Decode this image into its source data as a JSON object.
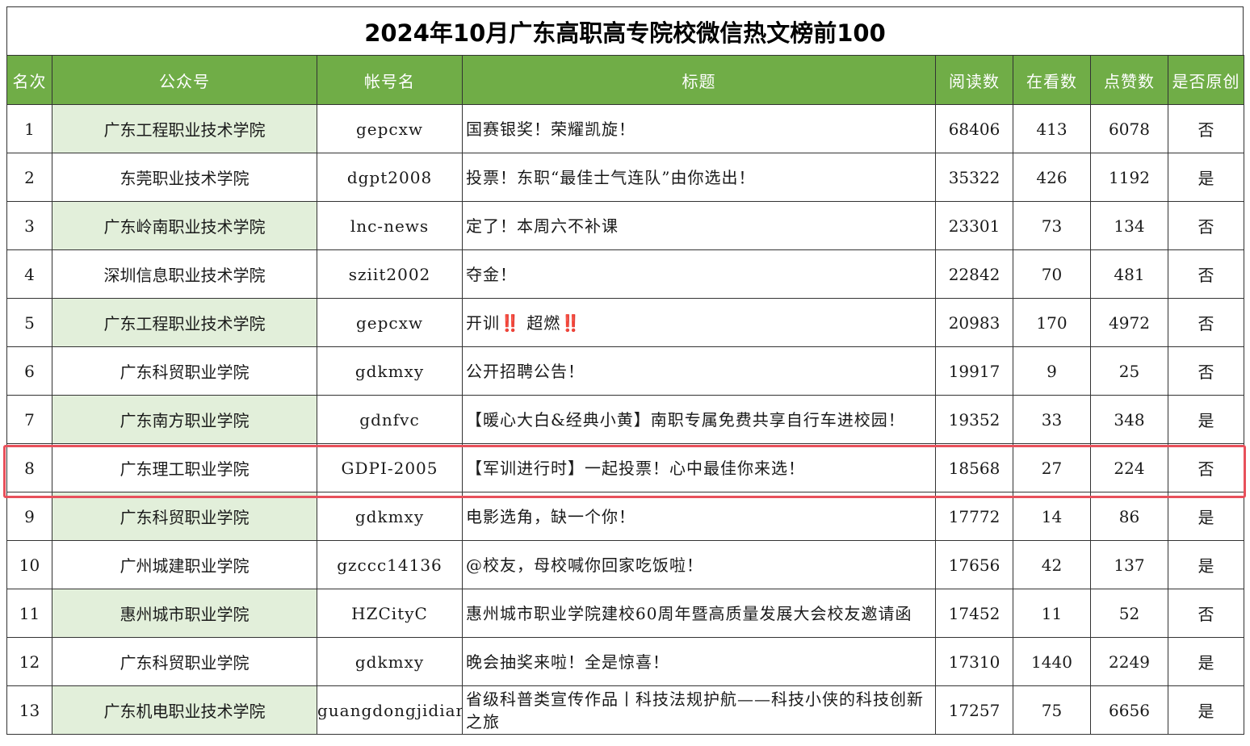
{
  "title": "2024年10月广东高职高专院校微信热文榜前100",
  "headers": {
    "rank": "名次",
    "account": "公众号",
    "account_id": "帐号名",
    "article_title": "标题",
    "reads": "阅读数",
    "watching": "在看数",
    "likes": "点赞数",
    "original": "是否原创"
  },
  "colors": {
    "header_bg": "#70ad47",
    "row_shade": "#e2efda",
    "highlight_border": "#e8505b"
  },
  "highlighted_rank": "8",
  "rows": [
    {
      "rank": "1",
      "account": "广东工程职业技术学院",
      "account_id": "gepcxw",
      "title": "国赛银奖！荣耀凯旋！",
      "reads": "68406",
      "watching": "413",
      "likes": "6078",
      "original": "否"
    },
    {
      "rank": "2",
      "account": "东莞职业技术学院",
      "account_id": "dgpt2008",
      "title": "投票！东职“最佳士气连队”由你选出！",
      "reads": "35322",
      "watching": "426",
      "likes": "1192",
      "original": "是"
    },
    {
      "rank": "3",
      "account": "广东岭南职业技术学院",
      "account_id": "lnc-news",
      "title": "定了！本周六不补课",
      "reads": "23301",
      "watching": "73",
      "likes": "134",
      "original": "否"
    },
    {
      "rank": "4",
      "account": "深圳信息职业技术学院",
      "account_id": "sziit2002",
      "title": "夺金！",
      "reads": "22842",
      "watching": "70",
      "likes": "481",
      "original": "否"
    },
    {
      "rank": "5",
      "account": "广东工程职业技术学院",
      "account_id": "gepcxw",
      "title": "开训‼️ 超燃‼️",
      "reads": "20983",
      "watching": "170",
      "likes": "4972",
      "original": "否"
    },
    {
      "rank": "6",
      "account": "广东科贸职业学院",
      "account_id": "gdkmxy",
      "title": "公开招聘公告！",
      "reads": "19917",
      "watching": "9",
      "likes": "25",
      "original": "否"
    },
    {
      "rank": "7",
      "account": "广东南方职业学院",
      "account_id": "gdnfvc",
      "title": "【暖心大白&经典小黄】南职专属免费共享自行车进校园！",
      "reads": "19352",
      "watching": "33",
      "likes": "348",
      "original": "是"
    },
    {
      "rank": "8",
      "account": "广东理工职业学院",
      "account_id": "GDPI-2005",
      "title": "【军训进行时】一起投票！心中最佳你来选！",
      "reads": "18568",
      "watching": "27",
      "likes": "224",
      "original": "否"
    },
    {
      "rank": "9",
      "account": "广东科贸职业学院",
      "account_id": "gdkmxy",
      "title": "电影选角，缺一个你！",
      "reads": "17772",
      "watching": "14",
      "likes": "86",
      "original": "是"
    },
    {
      "rank": "10",
      "account": "广州城建职业学院",
      "account_id": "gzccc14136",
      "title": "@校友，母校喊你回家吃饭啦！",
      "reads": "17656",
      "watching": "42",
      "likes": "137",
      "original": "是"
    },
    {
      "rank": "11",
      "account": "惠州城市职业学院",
      "account_id": "HZCityC",
      "title": "惠州城市职业学院建校60周年暨高质量发展大会校友邀请函",
      "reads": "17452",
      "watching": "11",
      "likes": "52",
      "original": "否"
    },
    {
      "rank": "12",
      "account": "广东科贸职业学院",
      "account_id": "gdkmxy",
      "title": "晚会抽奖来啦！全是惊喜！",
      "reads": "17310",
      "watching": "1440",
      "likes": "2249",
      "original": "是"
    },
    {
      "rank": "13",
      "account": "广东机电职业技术学院",
      "account_id": "guangdongjidian",
      "title": "省级科普类宣传作品丨科技法规护航——科技小侠的科技创新之旅",
      "reads": "17257",
      "watching": "75",
      "likes": "6656",
      "original": "是"
    }
  ]
}
